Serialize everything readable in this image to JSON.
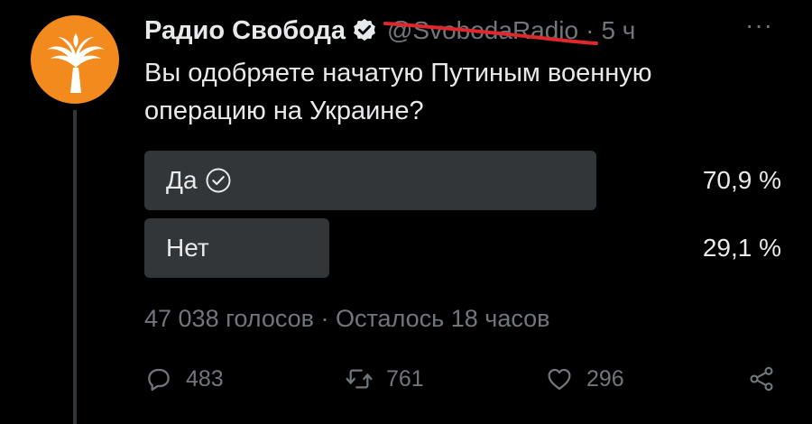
{
  "tweet": {
    "author": {
      "name": "Радио Свобода",
      "handle": "@SvobodaRadio",
      "verified": true,
      "avatar_icon": "rfe-rl-torch-logo",
      "avatar_color": "#f28a1d"
    },
    "separator": "·",
    "time": "5 ч",
    "more_label": "···",
    "text": "Вы одобряете начатую Путиным военную операцию на Украине?",
    "poll": {
      "options": [
        {
          "label": "Да",
          "percent": "70,9 %",
          "share": 0.709,
          "winner": true
        },
        {
          "label": "Нет",
          "percent": "29,1 %",
          "share": 0.291,
          "winner": false
        }
      ],
      "meta": "47 038 голосов · Осталось 18 часов"
    },
    "actions": {
      "replies": "483",
      "retweets": "761",
      "likes": "296"
    }
  },
  "colors": {
    "background": "#000000",
    "text": "#e7e9ea",
    "muted": "#71767b",
    "poll_fill": "#333639",
    "strike_red": "#e0272c"
  }
}
